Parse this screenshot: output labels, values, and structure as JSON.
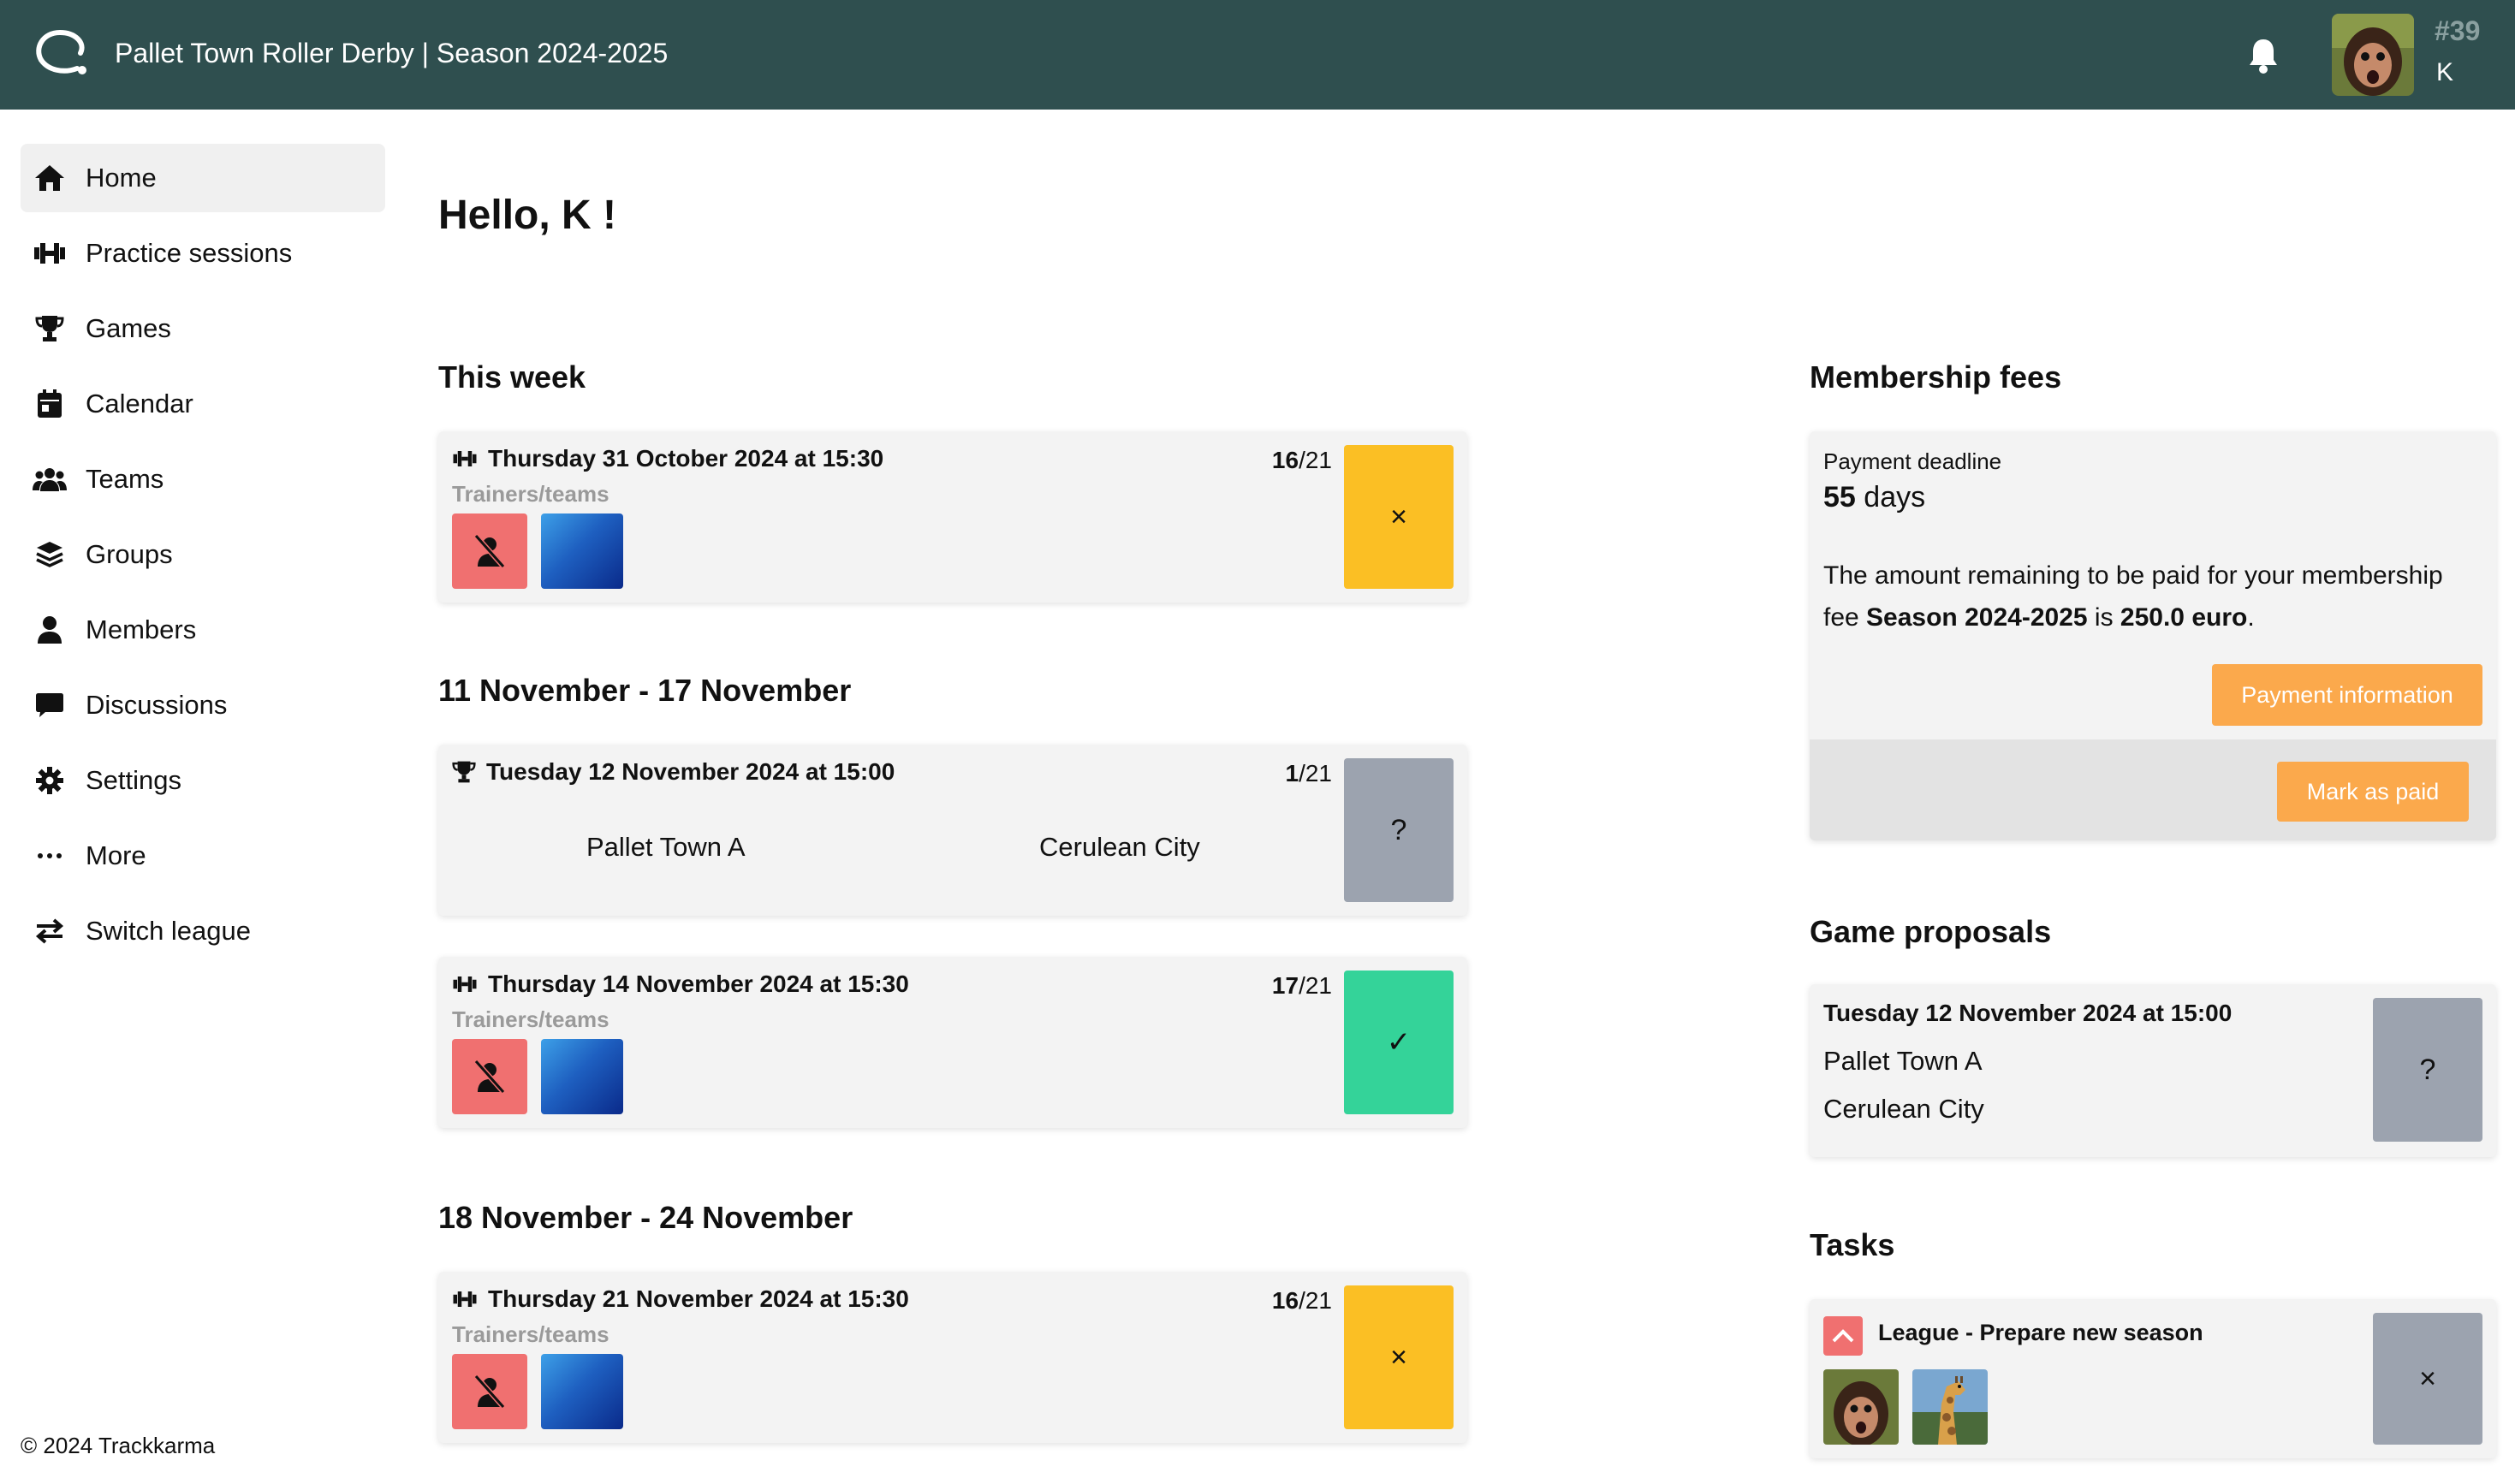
{
  "header": {
    "title": "Pallet Town Roller Derby | Season 2024-2025",
    "user_number": "#39",
    "user_initial": "K"
  },
  "sidebar": {
    "items": [
      {
        "label": "Home",
        "icon": "home-icon"
      },
      {
        "label": "Practice sessions",
        "icon": "dumbbell-icon"
      },
      {
        "label": "Games",
        "icon": "trophy-icon"
      },
      {
        "label": "Calendar",
        "icon": "calendar-icon"
      },
      {
        "label": "Teams",
        "icon": "users-icon"
      },
      {
        "label": "Groups",
        "icon": "layers-icon"
      },
      {
        "label": "Members",
        "icon": "user-icon"
      },
      {
        "label": "Discussions",
        "icon": "chat-icon"
      },
      {
        "label": "Settings",
        "icon": "gear-icon"
      },
      {
        "label": "More",
        "icon": "ellipsis-icon"
      },
      {
        "label": "Switch league",
        "icon": "switch-icon"
      }
    ]
  },
  "footer": "© 2024 Trackkarma",
  "main": {
    "greeting": "Hello, K !",
    "sections": [
      {
        "title": "This week"
      },
      {
        "title": "11 November - 17 November"
      },
      {
        "title": "18 November - 24 November"
      }
    ],
    "events": [
      {
        "type": "practice",
        "date": "Thursday 31 October 2024 at 15:30",
        "count": "16",
        "total": "/21",
        "sub": "Trainers/teams",
        "rsvp": "×"
      },
      {
        "type": "game",
        "date": "Tuesday 12 November 2024 at 15:00",
        "count": "1",
        "total": "/21",
        "home": "Pallet Town A",
        "away": "Cerulean City",
        "rsvp": "?"
      },
      {
        "type": "practice",
        "date": "Thursday 14 November 2024 at 15:30",
        "count": "17",
        "total": "/21",
        "sub": "Trainers/teams",
        "rsvp": "✓"
      },
      {
        "type": "practice",
        "date": "Thursday 21 November 2024 at 15:30",
        "count": "16",
        "total": "/21",
        "sub": "Trainers/teams",
        "rsvp": "×"
      }
    ]
  },
  "fees": {
    "title": "Membership fees",
    "deadline_label": "Payment deadline",
    "days_value": "55",
    "days_unit": "days",
    "text_1": "The amount remaining to be paid for your membership fee ",
    "season": "Season 2024-2025",
    "text_2": " is ",
    "amount": "250.0 euro",
    "text_3": ".",
    "payment_info_label": "Payment information",
    "mark_paid_label": "Mark as paid"
  },
  "proposals": {
    "title": "Game proposals",
    "date": "Tuesday 12 November 2024 at 15:00",
    "home": "Pallet Town A",
    "away": "Cerulean City",
    "rsvp": "?"
  },
  "tasks": {
    "title": "Tasks",
    "task_title": "League - Prepare new season",
    "action": "×"
  },
  "colors": {
    "header_bg": "#2f4f4f",
    "rsvp_no": "#fbbf24",
    "rsvp_maybe": "#9ca3af",
    "rsvp_yes": "#34d399",
    "accent_orange": "#fba94c",
    "trainer_chip": "#f07070"
  }
}
